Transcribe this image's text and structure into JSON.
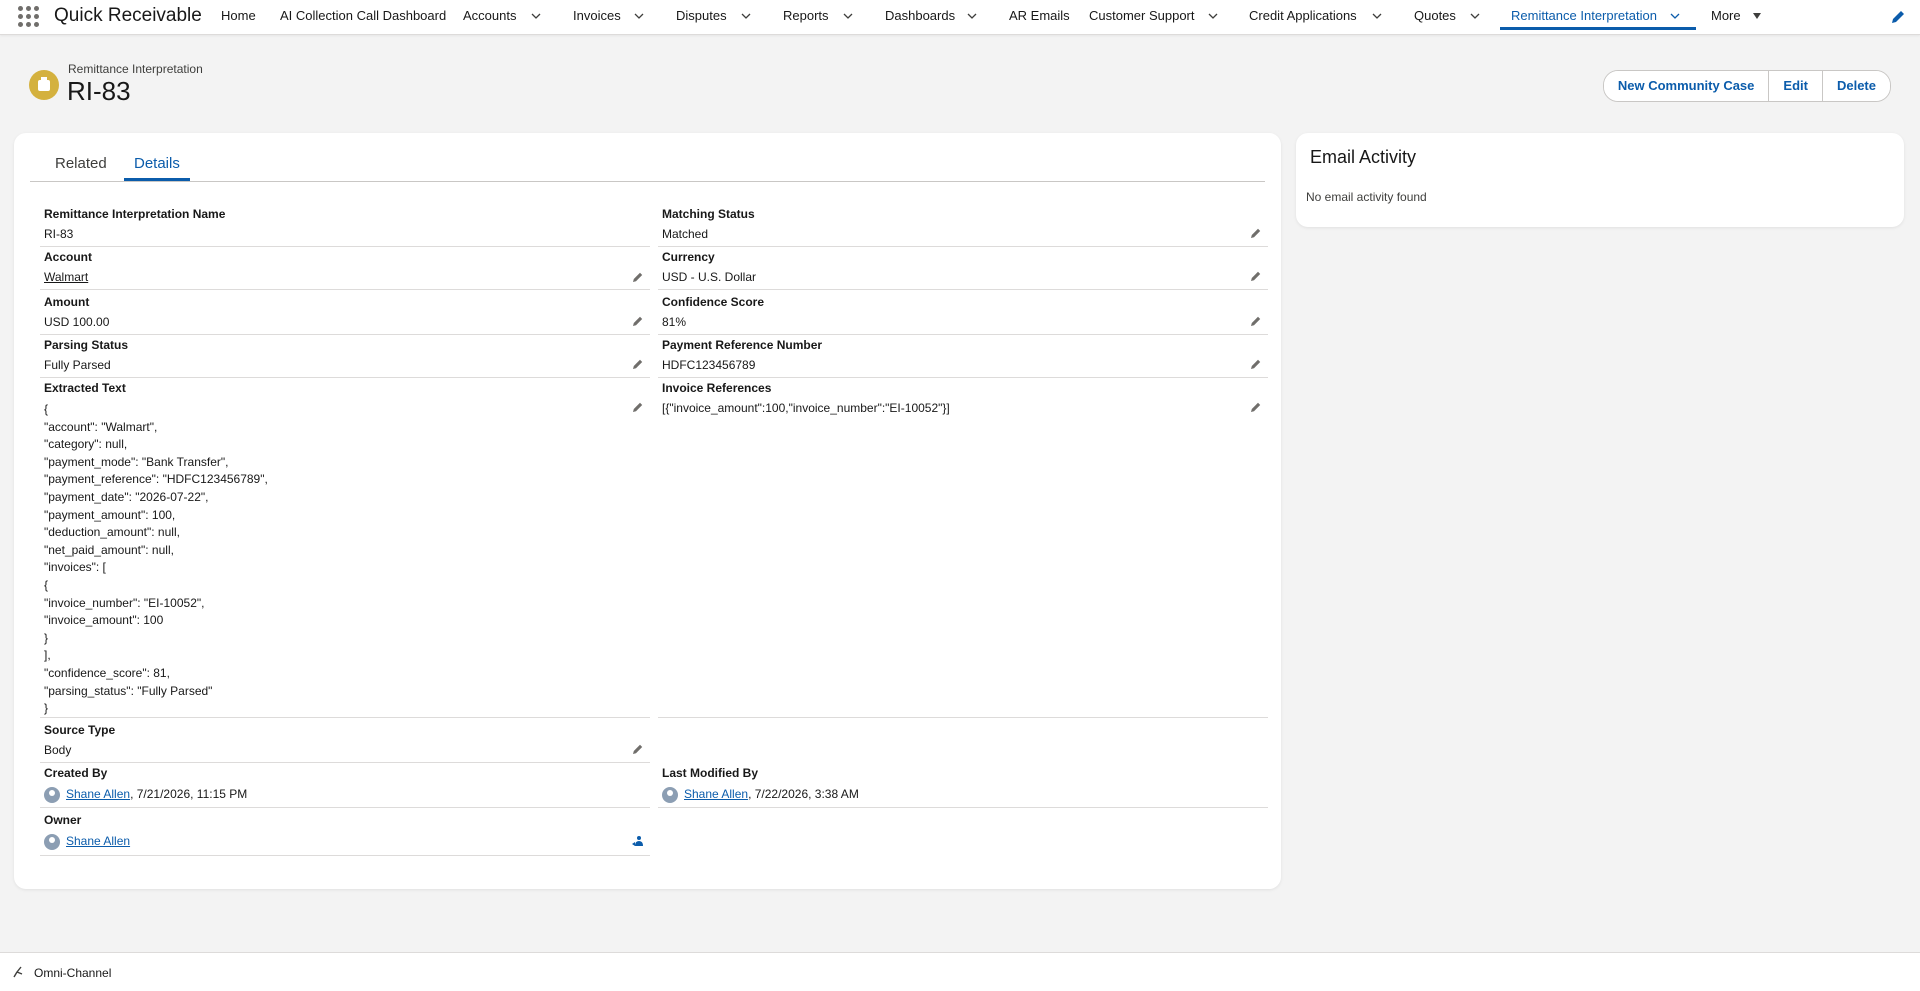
{
  "app": {
    "name": "Quick Receivable"
  },
  "nav": {
    "items": [
      {
        "label": "Home",
        "has_menu": false
      },
      {
        "label": "AI Collection Call Dashboard",
        "has_menu": false
      },
      {
        "label": "Accounts",
        "has_menu": true
      },
      {
        "label": "Invoices",
        "has_menu": true
      },
      {
        "label": "Disputes",
        "has_menu": true
      },
      {
        "label": "Reports",
        "has_menu": true
      },
      {
        "label": "Dashboards",
        "has_menu": true
      },
      {
        "label": "AR Emails",
        "has_menu": false
      },
      {
        "label": "Customer Support",
        "has_menu": true
      },
      {
        "label": "Credit Applications",
        "has_menu": true
      },
      {
        "label": "Quotes",
        "has_menu": true
      },
      {
        "label": "Remittance Interpretation",
        "has_menu": true,
        "active": true
      },
      {
        "label": "More",
        "has_menu": true
      }
    ]
  },
  "header": {
    "object_label": "Remittance Interpretation",
    "record_name": "RI-83",
    "actions": [
      "New Community Case",
      "Edit",
      "Delete"
    ]
  },
  "tabs": [
    "Related",
    "Details"
  ],
  "active_tab": "Details",
  "details": {
    "remittance_name": {
      "label": "Remittance Interpretation Name",
      "value": "RI-83"
    },
    "matching_status": {
      "label": "Matching Status",
      "value": "Matched"
    },
    "account": {
      "label": "Account",
      "value": "Walmart"
    },
    "currency": {
      "label": "Currency",
      "value": "USD - U.S. Dollar"
    },
    "amount": {
      "label": "Amount",
      "value": "USD 100.00"
    },
    "confidence": {
      "label": "Confidence Score",
      "value": "81%"
    },
    "parsing_status": {
      "label": "Parsing Status",
      "value": "Fully Parsed"
    },
    "payment_ref": {
      "label": "Payment Reference Number",
      "value": "HDFC123456789"
    },
    "extracted_text": {
      "label": "Extracted Text",
      "lines": [
        "{",
        "\"account\": \"Walmart\",",
        "\"category\": null,",
        "\"payment_mode\": \"Bank Transfer\",",
        "\"payment_reference\": \"HDFC123456789\",",
        "\"payment_date\": \"2026-07-22\",",
        "\"payment_amount\": 100,",
        "\"deduction_amount\": null,",
        "\"net_paid_amount\": null,",
        "\"invoices\": [",
        "{",
        "\"invoice_number\": \"EI-10052\",",
        "\"invoice_amount\": 100",
        "}",
        "],",
        "\"confidence_score\": 81,",
        "\"parsing_status\": \"Fully Parsed\"",
        "}"
      ]
    },
    "invoice_refs": {
      "label": "Invoice References",
      "value": "[{\"invoice_amount\":100,\"invoice_number\":\"EI-10052\"}]"
    },
    "source_type": {
      "label": "Source Type",
      "value": "Body"
    },
    "created_by": {
      "label": "Created By",
      "user": "Shane Allen",
      "date": ", 7/21/2026, 11:15 PM"
    },
    "modified_by": {
      "label": "Last Modified By",
      "user": "Shane Allen",
      "date": ", 7/22/2026, 3:38 AM"
    },
    "owner": {
      "label": "Owner",
      "user": "Shane Allen"
    }
  },
  "email_activity": {
    "title": "Email Activity",
    "empty_text": "No email activity found"
  },
  "utility_bar": {
    "label": "Omni-Channel"
  },
  "colors": {
    "brand": "#0b5cab",
    "record_icon": "#d4b13e",
    "background": "#f3f3f3"
  }
}
